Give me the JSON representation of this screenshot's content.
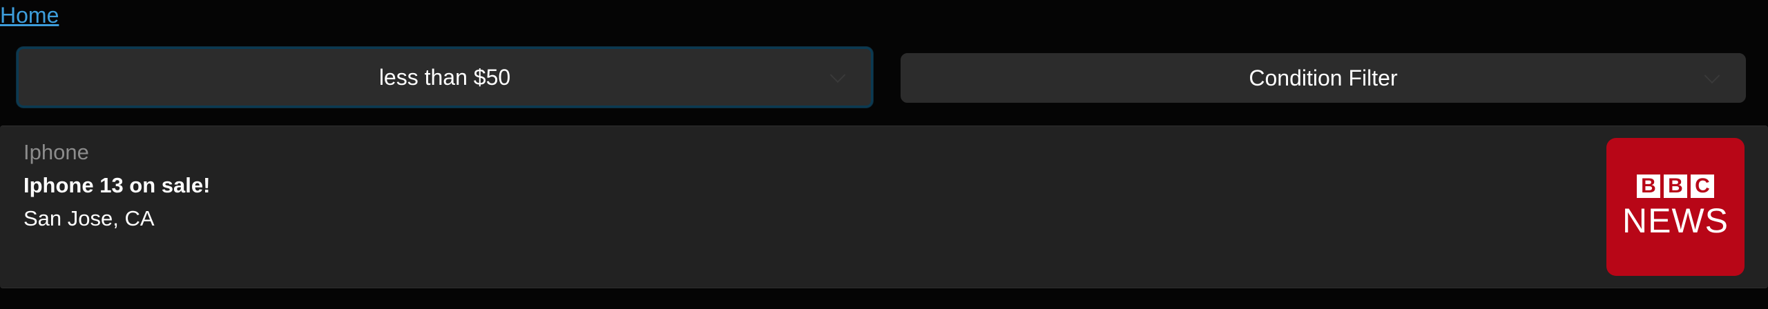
{
  "nav": {
    "home_label": "Home"
  },
  "filters": {
    "price": {
      "selected": "less than $50"
    },
    "condition": {
      "selected": "Condition Filter"
    }
  },
  "listing": {
    "category": "Iphone",
    "title": "Iphone 13 on sale!",
    "location": "San Jose, CA",
    "thumbnail": {
      "logo_letters": [
        "B",
        "B",
        "C"
      ],
      "logo_word": "NEWS",
      "background_color": "#b80617"
    }
  },
  "colors": {
    "link": "#3d9ddb",
    "background": "#050505",
    "card": "#222222",
    "select": "#2c2c2c",
    "focus_border": "#0b3a52"
  }
}
